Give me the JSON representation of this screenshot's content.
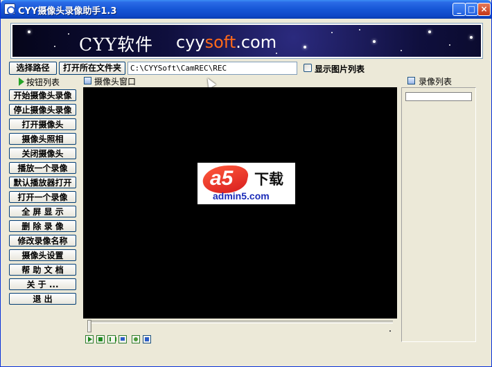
{
  "window": {
    "title": "CYY摄像头录像助手1.3",
    "controls": {
      "minimize": "_",
      "maximize": "□",
      "close": "×"
    }
  },
  "banner": {
    "text": "CYY软件",
    "url_prefix": "cyy",
    "url_highlight": "soft",
    "url_suffix": ".com",
    "colors": {
      "highlight": "#ff6a1a",
      "background": "#0f0f3d"
    }
  },
  "toolbar": {
    "select_path_label": "选择路径",
    "open_folder_label": "打开所在文件夹",
    "path_value": "C:\\CYYSoft\\CamREC\\REC",
    "show_images_label": "显示图片列表"
  },
  "sidebar": {
    "header": "按钮列表",
    "buttons": [
      "开始摄像头录像",
      "停止摄像头录像",
      "打开摄像头",
      "摄像头照相",
      "关闭摄像头",
      "播放一个录像",
      "默认播放器打开",
      "打开一个录像",
      "全 屏 显 示",
      "删 除 录 像",
      "修改录像名称",
      "摄像头设置",
      "帮 助 文 档",
      "关 于 ...",
      "退   出"
    ]
  },
  "camera": {
    "header": "摄像头窗口",
    "watermark": {
      "mark": "a5",
      "title": "下载",
      "url": "admin5.com"
    },
    "controls": [
      "play-icon",
      "stop-icon",
      "pause-icon",
      "monitor-icon",
      "photo-icon",
      "save-icon"
    ]
  },
  "recordings": {
    "header": "录像列表"
  },
  "colors": {
    "title_bar": "#0e47c7",
    "window_bg": "#ece9d8",
    "video_bg": "#000000",
    "accent_green": "#27a327"
  }
}
